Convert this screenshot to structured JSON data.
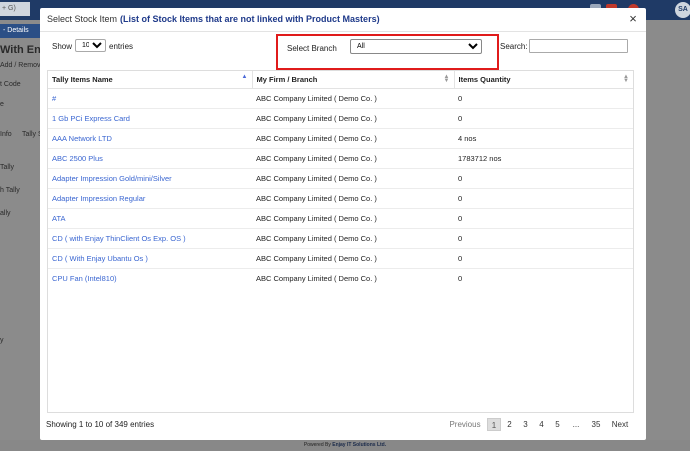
{
  "background": {
    "search_text": "+ G)",
    "tab_label": "- Details",
    "page_title": "With Enj",
    "texts": [
      "Add / Remov",
      "t Code",
      "e",
      "Info",
      "Tally S",
      "Tally",
      "h Tally",
      "ally",
      "",
      "y"
    ],
    "avatar": "SA",
    "footer_prefix": "Powered By",
    "footer_brand": "Enjay IT Solutions Ltd."
  },
  "modal": {
    "title": "Select Stock Item",
    "subtitle": "(List of Stock Items that are not linked with Product Masters)",
    "close": "×"
  },
  "controls": {
    "show_label": "Show",
    "length_value": "10",
    "entries_label": "entries",
    "branch_label": "Select Branch",
    "branch_value": "All",
    "search_label": "Search:"
  },
  "table": {
    "columns": [
      "Tally Items Name",
      "My Firm / Branch",
      "Items Quantity"
    ],
    "rows": [
      [
        "#",
        "ABC Company Limited ( Demo Co. )",
        "0"
      ],
      [
        "1 Gb PCi Express Card",
        "ABC Company Limited ( Demo Co. )",
        "0"
      ],
      [
        "AAA Network LTD",
        "ABC Company Limited ( Demo Co. )",
        "4 nos"
      ],
      [
        "ABC 2500 Plus",
        "ABC Company Limited ( Demo Co. )",
        "1783712 nos"
      ],
      [
        "Adapter Impression Gold/mini/Silver",
        "ABC Company Limited ( Demo Co. )",
        "0"
      ],
      [
        "Adapter Impression Regular",
        "ABC Company Limited ( Demo Co. )",
        "0"
      ],
      [
        "ATA",
        "ABC Company Limited ( Demo Co. )",
        "0"
      ],
      [
        "CD ( with Enjay ThinClient Os Exp. OS )",
        "ABC Company Limited ( Demo Co. )",
        "0"
      ],
      [
        "CD ( With Enjay Ubantu Os )",
        "ABC Company Limited ( Demo Co. )",
        "0"
      ],
      [
        "CPU Fan (Intel810)",
        "ABC Company Limited ( Demo Co. )",
        "0"
      ]
    ]
  },
  "footer": {
    "info": "Showing 1 to 10 of 349 entries",
    "previous": "Previous",
    "pages": [
      "1",
      "2",
      "3",
      "4",
      "5",
      "...",
      "35"
    ],
    "next": "Next"
  },
  "colors": {
    "highlight_border": "#e01b1b",
    "link": "#3a66d1",
    "subtitle": "#1f3a8a"
  }
}
